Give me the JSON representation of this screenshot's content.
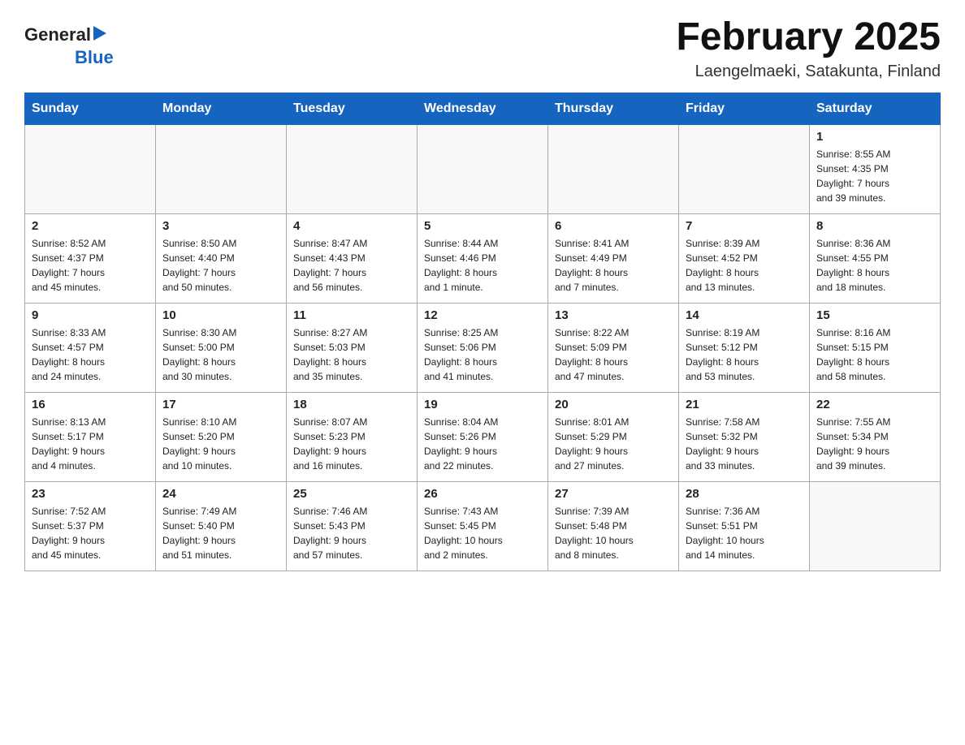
{
  "header": {
    "logo": {
      "text_general": "General",
      "text_blue": "Blue"
    },
    "title": "February 2025",
    "location": "Laengelmaeki, Satakunta, Finland"
  },
  "days_of_week": [
    "Sunday",
    "Monday",
    "Tuesday",
    "Wednesday",
    "Thursday",
    "Friday",
    "Saturday"
  ],
  "weeks": [
    [
      {
        "day": "",
        "info": ""
      },
      {
        "day": "",
        "info": ""
      },
      {
        "day": "",
        "info": ""
      },
      {
        "day": "",
        "info": ""
      },
      {
        "day": "",
        "info": ""
      },
      {
        "day": "",
        "info": ""
      },
      {
        "day": "1",
        "info": "Sunrise: 8:55 AM\nSunset: 4:35 PM\nDaylight: 7 hours\nand 39 minutes."
      }
    ],
    [
      {
        "day": "2",
        "info": "Sunrise: 8:52 AM\nSunset: 4:37 PM\nDaylight: 7 hours\nand 45 minutes."
      },
      {
        "day": "3",
        "info": "Sunrise: 8:50 AM\nSunset: 4:40 PM\nDaylight: 7 hours\nand 50 minutes."
      },
      {
        "day": "4",
        "info": "Sunrise: 8:47 AM\nSunset: 4:43 PM\nDaylight: 7 hours\nand 56 minutes."
      },
      {
        "day": "5",
        "info": "Sunrise: 8:44 AM\nSunset: 4:46 PM\nDaylight: 8 hours\nand 1 minute."
      },
      {
        "day": "6",
        "info": "Sunrise: 8:41 AM\nSunset: 4:49 PM\nDaylight: 8 hours\nand 7 minutes."
      },
      {
        "day": "7",
        "info": "Sunrise: 8:39 AM\nSunset: 4:52 PM\nDaylight: 8 hours\nand 13 minutes."
      },
      {
        "day": "8",
        "info": "Sunrise: 8:36 AM\nSunset: 4:55 PM\nDaylight: 8 hours\nand 18 minutes."
      }
    ],
    [
      {
        "day": "9",
        "info": "Sunrise: 8:33 AM\nSunset: 4:57 PM\nDaylight: 8 hours\nand 24 minutes."
      },
      {
        "day": "10",
        "info": "Sunrise: 8:30 AM\nSunset: 5:00 PM\nDaylight: 8 hours\nand 30 minutes."
      },
      {
        "day": "11",
        "info": "Sunrise: 8:27 AM\nSunset: 5:03 PM\nDaylight: 8 hours\nand 35 minutes."
      },
      {
        "day": "12",
        "info": "Sunrise: 8:25 AM\nSunset: 5:06 PM\nDaylight: 8 hours\nand 41 minutes."
      },
      {
        "day": "13",
        "info": "Sunrise: 8:22 AM\nSunset: 5:09 PM\nDaylight: 8 hours\nand 47 minutes."
      },
      {
        "day": "14",
        "info": "Sunrise: 8:19 AM\nSunset: 5:12 PM\nDaylight: 8 hours\nand 53 minutes."
      },
      {
        "day": "15",
        "info": "Sunrise: 8:16 AM\nSunset: 5:15 PM\nDaylight: 8 hours\nand 58 minutes."
      }
    ],
    [
      {
        "day": "16",
        "info": "Sunrise: 8:13 AM\nSunset: 5:17 PM\nDaylight: 9 hours\nand 4 minutes."
      },
      {
        "day": "17",
        "info": "Sunrise: 8:10 AM\nSunset: 5:20 PM\nDaylight: 9 hours\nand 10 minutes."
      },
      {
        "day": "18",
        "info": "Sunrise: 8:07 AM\nSunset: 5:23 PM\nDaylight: 9 hours\nand 16 minutes."
      },
      {
        "day": "19",
        "info": "Sunrise: 8:04 AM\nSunset: 5:26 PM\nDaylight: 9 hours\nand 22 minutes."
      },
      {
        "day": "20",
        "info": "Sunrise: 8:01 AM\nSunset: 5:29 PM\nDaylight: 9 hours\nand 27 minutes."
      },
      {
        "day": "21",
        "info": "Sunrise: 7:58 AM\nSunset: 5:32 PM\nDaylight: 9 hours\nand 33 minutes."
      },
      {
        "day": "22",
        "info": "Sunrise: 7:55 AM\nSunset: 5:34 PM\nDaylight: 9 hours\nand 39 minutes."
      }
    ],
    [
      {
        "day": "23",
        "info": "Sunrise: 7:52 AM\nSunset: 5:37 PM\nDaylight: 9 hours\nand 45 minutes."
      },
      {
        "day": "24",
        "info": "Sunrise: 7:49 AM\nSunset: 5:40 PM\nDaylight: 9 hours\nand 51 minutes."
      },
      {
        "day": "25",
        "info": "Sunrise: 7:46 AM\nSunset: 5:43 PM\nDaylight: 9 hours\nand 57 minutes."
      },
      {
        "day": "26",
        "info": "Sunrise: 7:43 AM\nSunset: 5:45 PM\nDaylight: 10 hours\nand 2 minutes."
      },
      {
        "day": "27",
        "info": "Sunrise: 7:39 AM\nSunset: 5:48 PM\nDaylight: 10 hours\nand 8 minutes."
      },
      {
        "day": "28",
        "info": "Sunrise: 7:36 AM\nSunset: 5:51 PM\nDaylight: 10 hours\nand 14 minutes."
      },
      {
        "day": "",
        "info": ""
      }
    ]
  ]
}
